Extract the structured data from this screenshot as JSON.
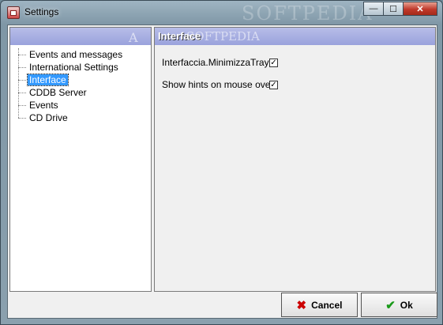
{
  "window": {
    "title": "Settings",
    "watermark": "SOFTPEDIA"
  },
  "caption_buttons": {
    "minimize": "—",
    "maximize": "☐",
    "close": "✕"
  },
  "tree": {
    "items": [
      {
        "label": "Events and messages",
        "selected": false
      },
      {
        "label": "International Settings",
        "selected": false
      },
      {
        "label": "Interface",
        "selected": true
      },
      {
        "label": "CDDB Server",
        "selected": false
      },
      {
        "label": "Events",
        "selected": false
      },
      {
        "label": "CD Drive",
        "selected": false
      }
    ],
    "watermark": "A"
  },
  "panel": {
    "title": "Interface",
    "watermark": "SOFTPEDIA",
    "options": [
      {
        "label": "Interfaccia.MinimizzaTray",
        "checked": true,
        "check_glyph": "✓"
      },
      {
        "label": "Show hints on mouse over",
        "checked": true,
        "check_glyph": "✓"
      }
    ]
  },
  "buttons": {
    "cancel_label": "Cancel",
    "cancel_icon": "✖",
    "ok_label": "Ok",
    "ok_icon": "✔"
  },
  "colors": {
    "selection": "#3399ff",
    "header_gradient_top": "#b7bde8",
    "cancel_icon": "#cc0000",
    "ok_icon": "#1a9a1a"
  }
}
